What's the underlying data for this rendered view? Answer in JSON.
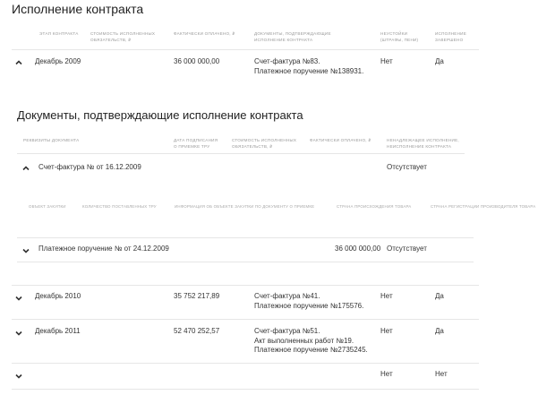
{
  "section1": {
    "title": "Исполнение контракта",
    "headers": {
      "stage": "Этап контракта",
      "cost_l1": "Стоимость исполненных",
      "cost_l2": "обязательств, ₽",
      "paid": "Фактически оплачено, ₽",
      "docs_l1": "Документы, подтверждающие",
      "docs_l2": "исполнение контракта",
      "penalty_l1": "Неустойки",
      "penalty_l2": "(штрафы, пени)",
      "done_l1": "Исполнение",
      "done_l2": "завершено"
    },
    "rows": [
      {
        "stage": "Декабрь 2009",
        "paid": "36 000 000,00",
        "doc1": "Счет-фактура №83.",
        "doc2": "Платежное поручение №138931.",
        "doc3": "",
        "penalty": "Нет",
        "done": "Да"
      },
      {
        "stage": "Декабрь 2010",
        "paid": "35 752 217,89",
        "doc1": "Счет-фактура №41.",
        "doc2": "Платежное поручение №175576.",
        "doc3": "",
        "penalty": "Нет",
        "done": "Да"
      },
      {
        "stage": "Декабрь 2011",
        "paid": "52 470 252,57",
        "doc1": "Счет-фактура №51.",
        "doc2": "Акт выполненных работ №19.",
        "doc3": "Платежное поручение №2735245.",
        "penalty": "Нет",
        "done": "Да"
      },
      {
        "stage": "",
        "paid": "",
        "doc1": "",
        "doc2": "",
        "doc3": "",
        "penalty": "Нет",
        "done": "Нет"
      }
    ]
  },
  "section2": {
    "title": "Документы, подтверждающие исполнение контракта",
    "headers": {
      "requisites": "Реквизиты документа",
      "date_l1": "Дата подписания",
      "date_l2": "о приемке ТРУ",
      "cost_l1": "Стоимость исполненных",
      "cost_l2": "обязательств, ₽",
      "paid": "Фактически оплачено, ₽",
      "improper_l1": "Ненадлежащее исполнение,",
      "improper_l2": "неисполнение контракта"
    },
    "doc1": {
      "name": "Счет-фактура № от 16.12.2009",
      "status": "Отсутствует"
    },
    "subheaders": {
      "object": "Объект закупки",
      "qty": "Количество поставленных ТРУ",
      "info": "Информация об объекте закупки по документу о приемке",
      "country": "Страна происхождения товара",
      "reg_country": "Страна регистрации производителя товара"
    },
    "doc2": {
      "name": "Платежное поручение № от 24.12.2009",
      "paid": "36 000 000,00",
      "status": "Отсутствует"
    }
  }
}
